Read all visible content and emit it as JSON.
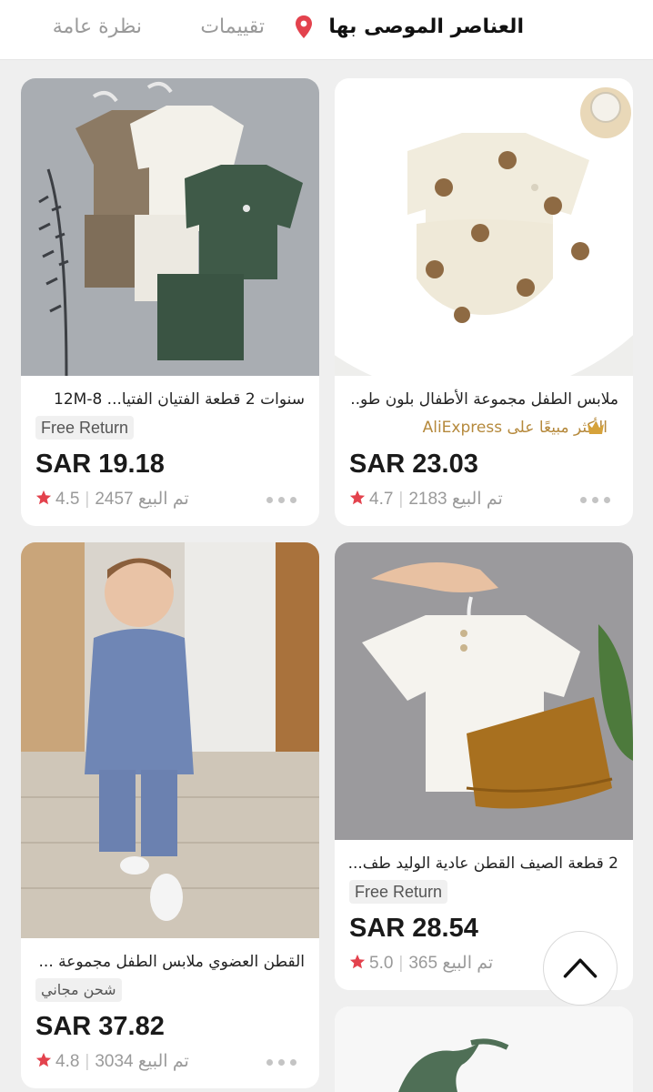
{
  "tabs": {
    "recommended": "العناصر الموصى بها",
    "reviews": "تقييمات",
    "overview": "نظرة عامة"
  },
  "colors": {
    "accent": "#e3424d",
    "gold": "#b5893c",
    "background": "#efefef"
  },
  "products": [
    {
      "title": "سنوات 2 قطعة الفتيان الفتيا... 8-12M",
      "badge": "Free Return",
      "price": "SAR 19.18",
      "rating": "4.5",
      "sold": "2457 تم البيع",
      "image": "four-linen-kids-outfits-on-hangers"
    },
    {
      "title": "ملابس الطفل مجموعة الأطفال بلون طو...",
      "bestseller": "الأكثر مبيعًا على AliExpress",
      "price": "SAR 23.03",
      "rating": "4.7",
      "sold": "2183 تم البيع",
      "image": "teddy-bear-print-baby-set"
    },
    {
      "title": "القطن العضوي ملابس الطفل مجموعة ...",
      "badge": "شحن مجاني",
      "price": "SAR 37.82",
      "rating": "4.8",
      "sold": "3034 تم البيع",
      "image": "toddler-in-blue-linen-set"
    },
    {
      "title": "2 قطعة الصيف القطن عادية الوليد طف...",
      "badge": "Free Return",
      "price": "SAR 28.54",
      "rating": "5.0",
      "sold": "365 تم البيع",
      "image": "white-shirt-brown-shorts-on-hanger"
    }
  ]
}
